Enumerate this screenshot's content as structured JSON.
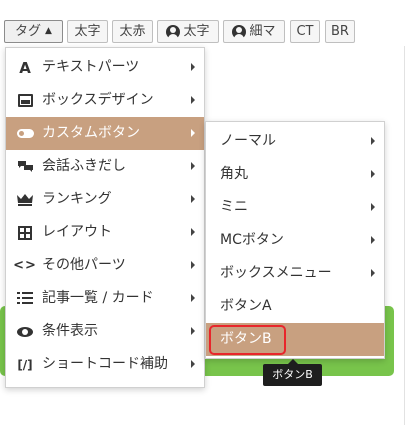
{
  "toolbar": {
    "tag_label": "タグ",
    "bold_label": "太字",
    "red_bold_label": "太赤",
    "user_bold_label": "太字",
    "user_thin_label": "細マ",
    "ct_label": "CT",
    "br_label": "BR"
  },
  "menu": {
    "items": [
      {
        "label": "テキストパーツ",
        "icon": "text-a-icon"
      },
      {
        "label": "ボックスデザイン",
        "icon": "box-icon"
      },
      {
        "label": "カスタムボタン",
        "icon": "toggle-icon"
      },
      {
        "label": "会話ふきだし",
        "icon": "chat-bubble-icon"
      },
      {
        "label": "ランキング",
        "icon": "crown-icon"
      },
      {
        "label": "レイアウト",
        "icon": "grid-icon"
      },
      {
        "label": "その他パーツ",
        "icon": "code-icon"
      },
      {
        "label": "記事一覧 / カード",
        "icon": "list-icon"
      },
      {
        "label": "条件表示",
        "icon": "eye-icon"
      },
      {
        "label": "ショートコード補助",
        "icon": "shortcode-icon"
      }
    ]
  },
  "submenu": {
    "items": [
      {
        "label": "ノーマル"
      },
      {
        "label": "角丸"
      },
      {
        "label": "ミニ"
      },
      {
        "label": "MCボタン"
      },
      {
        "label": "ボックスメニュー"
      },
      {
        "label": "ボタンA"
      },
      {
        "label": "ボタンB"
      }
    ]
  },
  "tooltip": {
    "text": "ボタンB"
  },
  "colors": {
    "active_bg": "#c8a080",
    "green_bar": "#78c44b",
    "focus_ring": "#e8262b",
    "tooltip_bg": "#1e1e1e"
  }
}
